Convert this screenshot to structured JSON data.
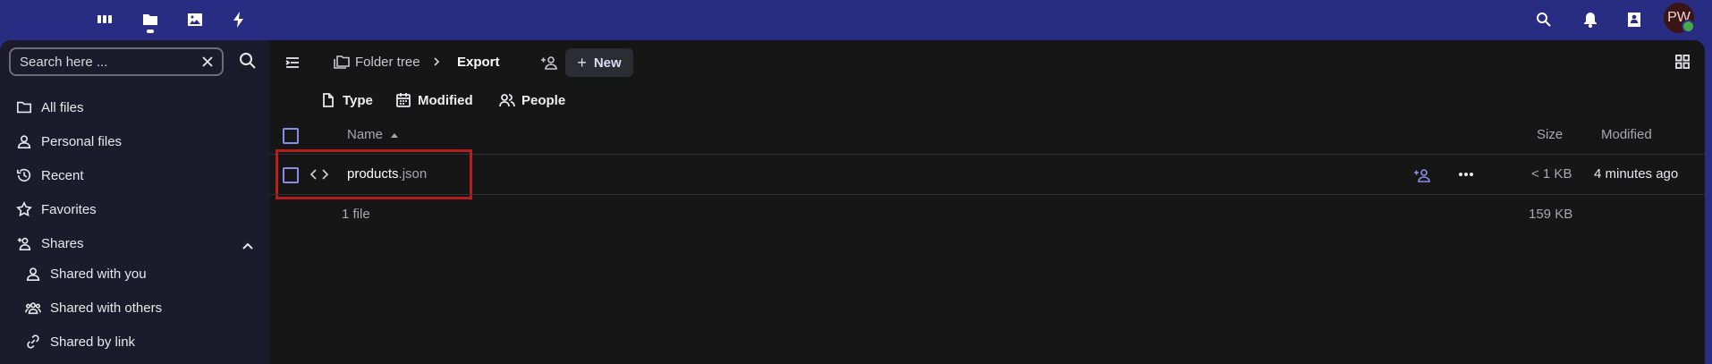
{
  "topbar": {
    "apps": [
      {
        "icon": "dashboard-icon"
      },
      {
        "icon": "files-folder-icon",
        "active": true
      },
      {
        "icon": "photos-icon"
      },
      {
        "icon": "activity-lightning-icon"
      }
    ],
    "right": [
      "search-icon",
      "notifications-bell-icon",
      "contacts-icon"
    ],
    "avatar_initials": "PW",
    "accent_color": "#282c82"
  },
  "sidebar": {
    "search_placeholder": "Search here ...",
    "items": [
      {
        "label": "All files",
        "icon": "folder-icon"
      },
      {
        "label": "Personal files",
        "icon": "person-icon"
      },
      {
        "label": "Recent",
        "icon": "history-icon"
      },
      {
        "label": "Favorites",
        "icon": "star-icon"
      },
      {
        "label": "Shares",
        "icon": "share-add-icon",
        "expanded": true
      },
      {
        "label": "Shared with you",
        "icon": "person-icon",
        "indent": true
      },
      {
        "label": "Shared with others",
        "icon": "people-icon",
        "indent": true
      },
      {
        "label": "Shared by link",
        "icon": "link-icon",
        "indent": true
      }
    ]
  },
  "breadcrumb": {
    "root": "Folder tree",
    "current": "Export",
    "new_label": "New"
  },
  "filters": {
    "type": "Type",
    "modified": "Modified",
    "people": "People"
  },
  "table": {
    "headers": {
      "name": "Name",
      "size": "Size",
      "modified": "Modified"
    },
    "rows": [
      {
        "basename": "products",
        "ext": ".json",
        "size": "< 1 KB",
        "modified": "4 minutes ago",
        "icon": "code-file-icon"
      }
    ],
    "summary": {
      "count": "1 file",
      "size": "159 KB"
    }
  }
}
